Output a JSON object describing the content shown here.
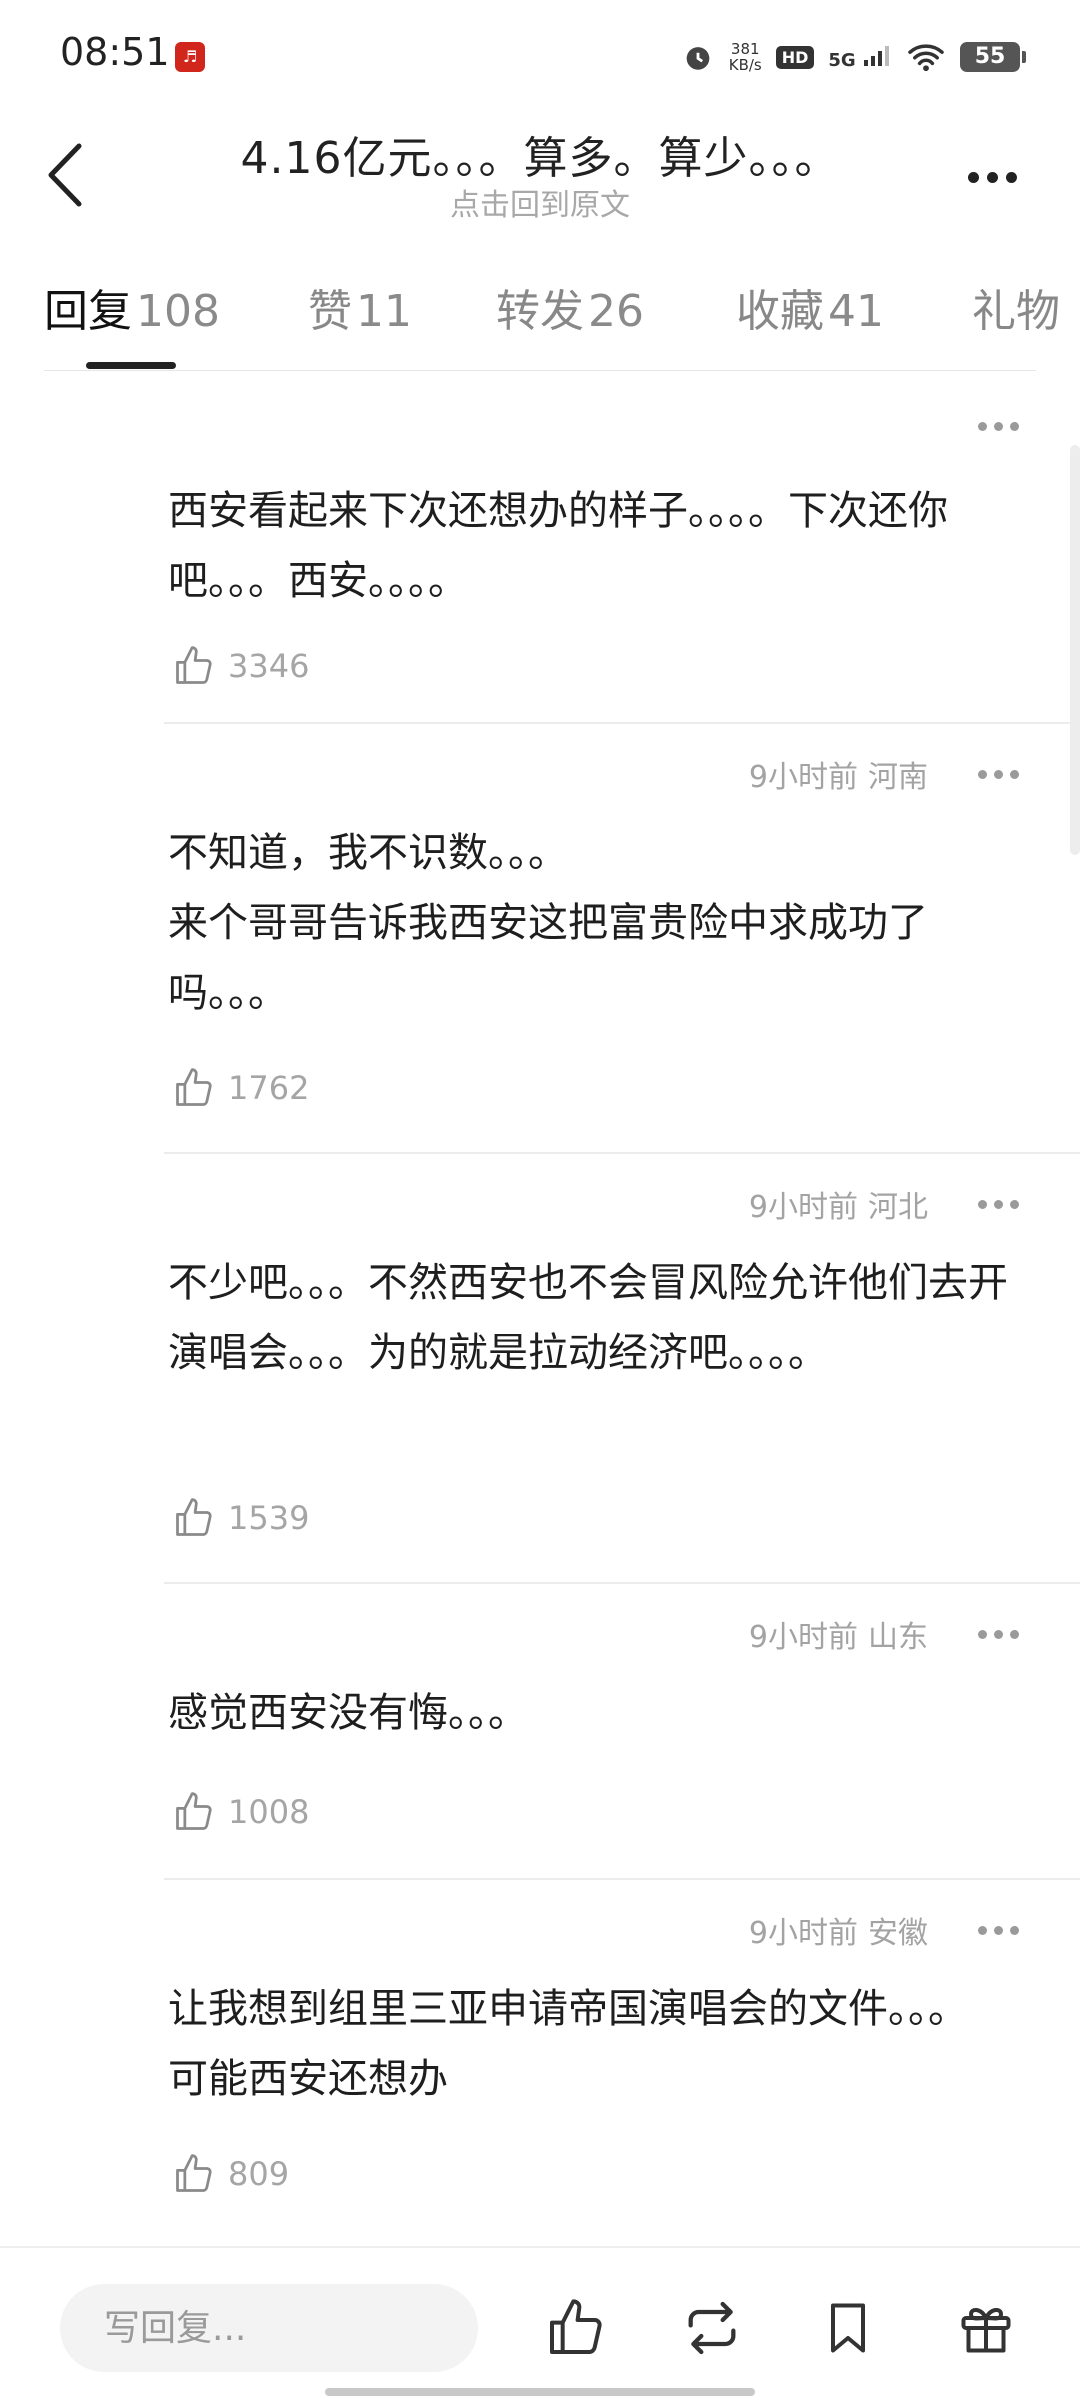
{
  "status": {
    "time": "08:51",
    "net_speed": "381",
    "net_unit": "KB/s",
    "hd": "HD",
    "network": "5G",
    "battery": "55"
  },
  "header": {
    "title": "4.16亿元。。。算多。算少。。。",
    "subtitle": "点击回到原文"
  },
  "tabs": [
    {
      "label": "回复",
      "count": "108"
    },
    {
      "label": "赞",
      "count": "11"
    },
    {
      "label": "转发",
      "count": "26"
    },
    {
      "label": "收藏",
      "count": "41"
    },
    {
      "label": "礼物",
      "count": ""
    }
  ],
  "comments": [
    {
      "time": "",
      "location": "",
      "text": "西安看起来下次还想办的样子。。。。下次还你吧。。。西安。。。。",
      "likes": "3346"
    },
    {
      "time": "9小时前",
      "location": "河南",
      "text": "不知道，我不识数。。。\n来个哥哥告诉我西安这把富贵险中求成功了吗。。。",
      "likes": "1762"
    },
    {
      "time": "9小时前",
      "location": "河北",
      "text": "不少吧。。。不然西安也不会冒风险允许他们去开演唱会。。。为的就是拉动经济吧。。。。",
      "likes": "1539"
    },
    {
      "time": "9小时前",
      "location": "山东",
      "text": "感觉西安没有悔。。。",
      "likes": "1008"
    },
    {
      "time": "9小时前",
      "location": "安徽",
      "text": "让我想到组里三亚申请帝国演唱会的文件。。。可能西安还想办",
      "likes": "809"
    }
  ],
  "bottom": {
    "reply_placeholder": "写回复..."
  }
}
